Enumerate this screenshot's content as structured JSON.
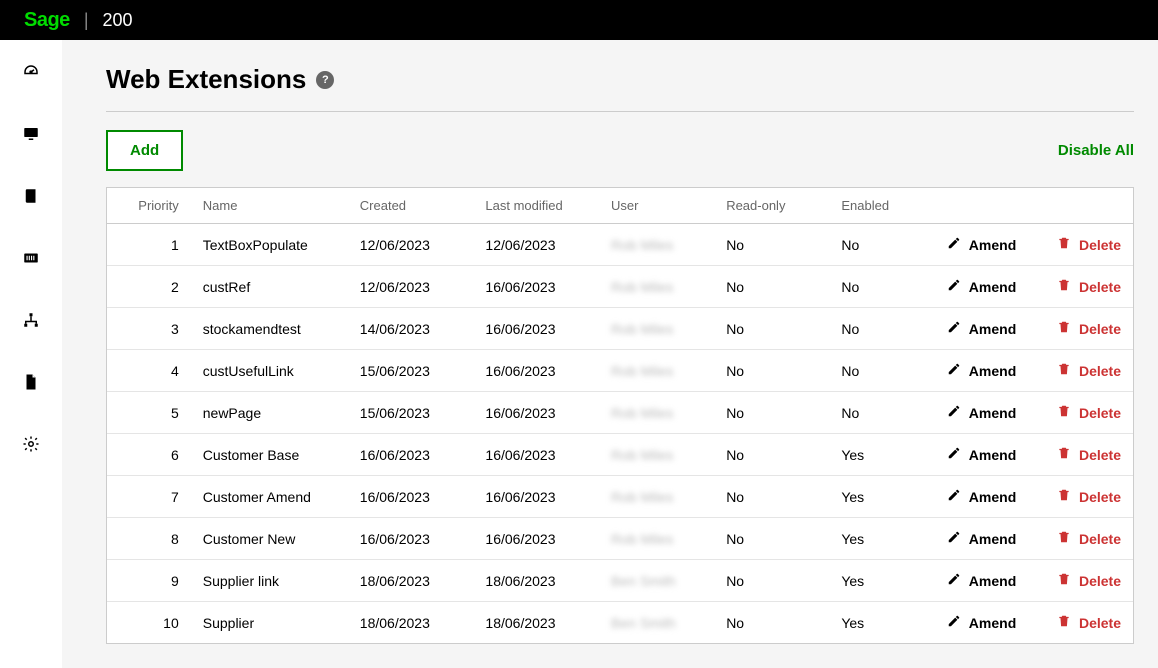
{
  "brand": {
    "logo": "Sage",
    "product": "200"
  },
  "page": {
    "title": "Web Extensions"
  },
  "toolbar": {
    "add_label": "Add",
    "disable_all_label": "Disable All"
  },
  "actions": {
    "amend_label": "Amend",
    "delete_label": "Delete"
  },
  "table": {
    "headers": {
      "priority": "Priority",
      "name": "Name",
      "created": "Created",
      "modified": "Last modified",
      "user": "User",
      "readonly": "Read-only",
      "enabled": "Enabled"
    },
    "rows": [
      {
        "priority": "1",
        "name": "TextBoxPopulate",
        "created": "12/06/2023",
        "modified": "12/06/2023",
        "user": "Rob Miles",
        "readonly": "No",
        "enabled": "No"
      },
      {
        "priority": "2",
        "name": "custRef",
        "created": "12/06/2023",
        "modified": "16/06/2023",
        "user": "Rob Miles",
        "readonly": "No",
        "enabled": "No"
      },
      {
        "priority": "3",
        "name": "stockamendtest",
        "created": "14/06/2023",
        "modified": "16/06/2023",
        "user": "Rob Miles",
        "readonly": "No",
        "enabled": "No"
      },
      {
        "priority": "4",
        "name": "custUsefulLink",
        "created": "15/06/2023",
        "modified": "16/06/2023",
        "user": "Rob Miles",
        "readonly": "No",
        "enabled": "No"
      },
      {
        "priority": "5",
        "name": "newPage",
        "created": "15/06/2023",
        "modified": "16/06/2023",
        "user": "Rob Miles",
        "readonly": "No",
        "enabled": "No"
      },
      {
        "priority": "6",
        "name": "Customer Base",
        "created": "16/06/2023",
        "modified": "16/06/2023",
        "user": "Rob Miles",
        "readonly": "No",
        "enabled": "Yes"
      },
      {
        "priority": "7",
        "name": "Customer Amend",
        "created": "16/06/2023",
        "modified": "16/06/2023",
        "user": "Rob Miles",
        "readonly": "No",
        "enabled": "Yes"
      },
      {
        "priority": "8",
        "name": "Customer New",
        "created": "16/06/2023",
        "modified": "16/06/2023",
        "user": "Rob Miles",
        "readonly": "No",
        "enabled": "Yes"
      },
      {
        "priority": "9",
        "name": "Supplier link",
        "created": "18/06/2023",
        "modified": "18/06/2023",
        "user": "Ben Smith",
        "readonly": "No",
        "enabled": "Yes"
      },
      {
        "priority": "10",
        "name": "Supplier",
        "created": "18/06/2023",
        "modified": "18/06/2023",
        "user": "Ben Smith",
        "readonly": "No",
        "enabled": "Yes"
      }
    ]
  }
}
